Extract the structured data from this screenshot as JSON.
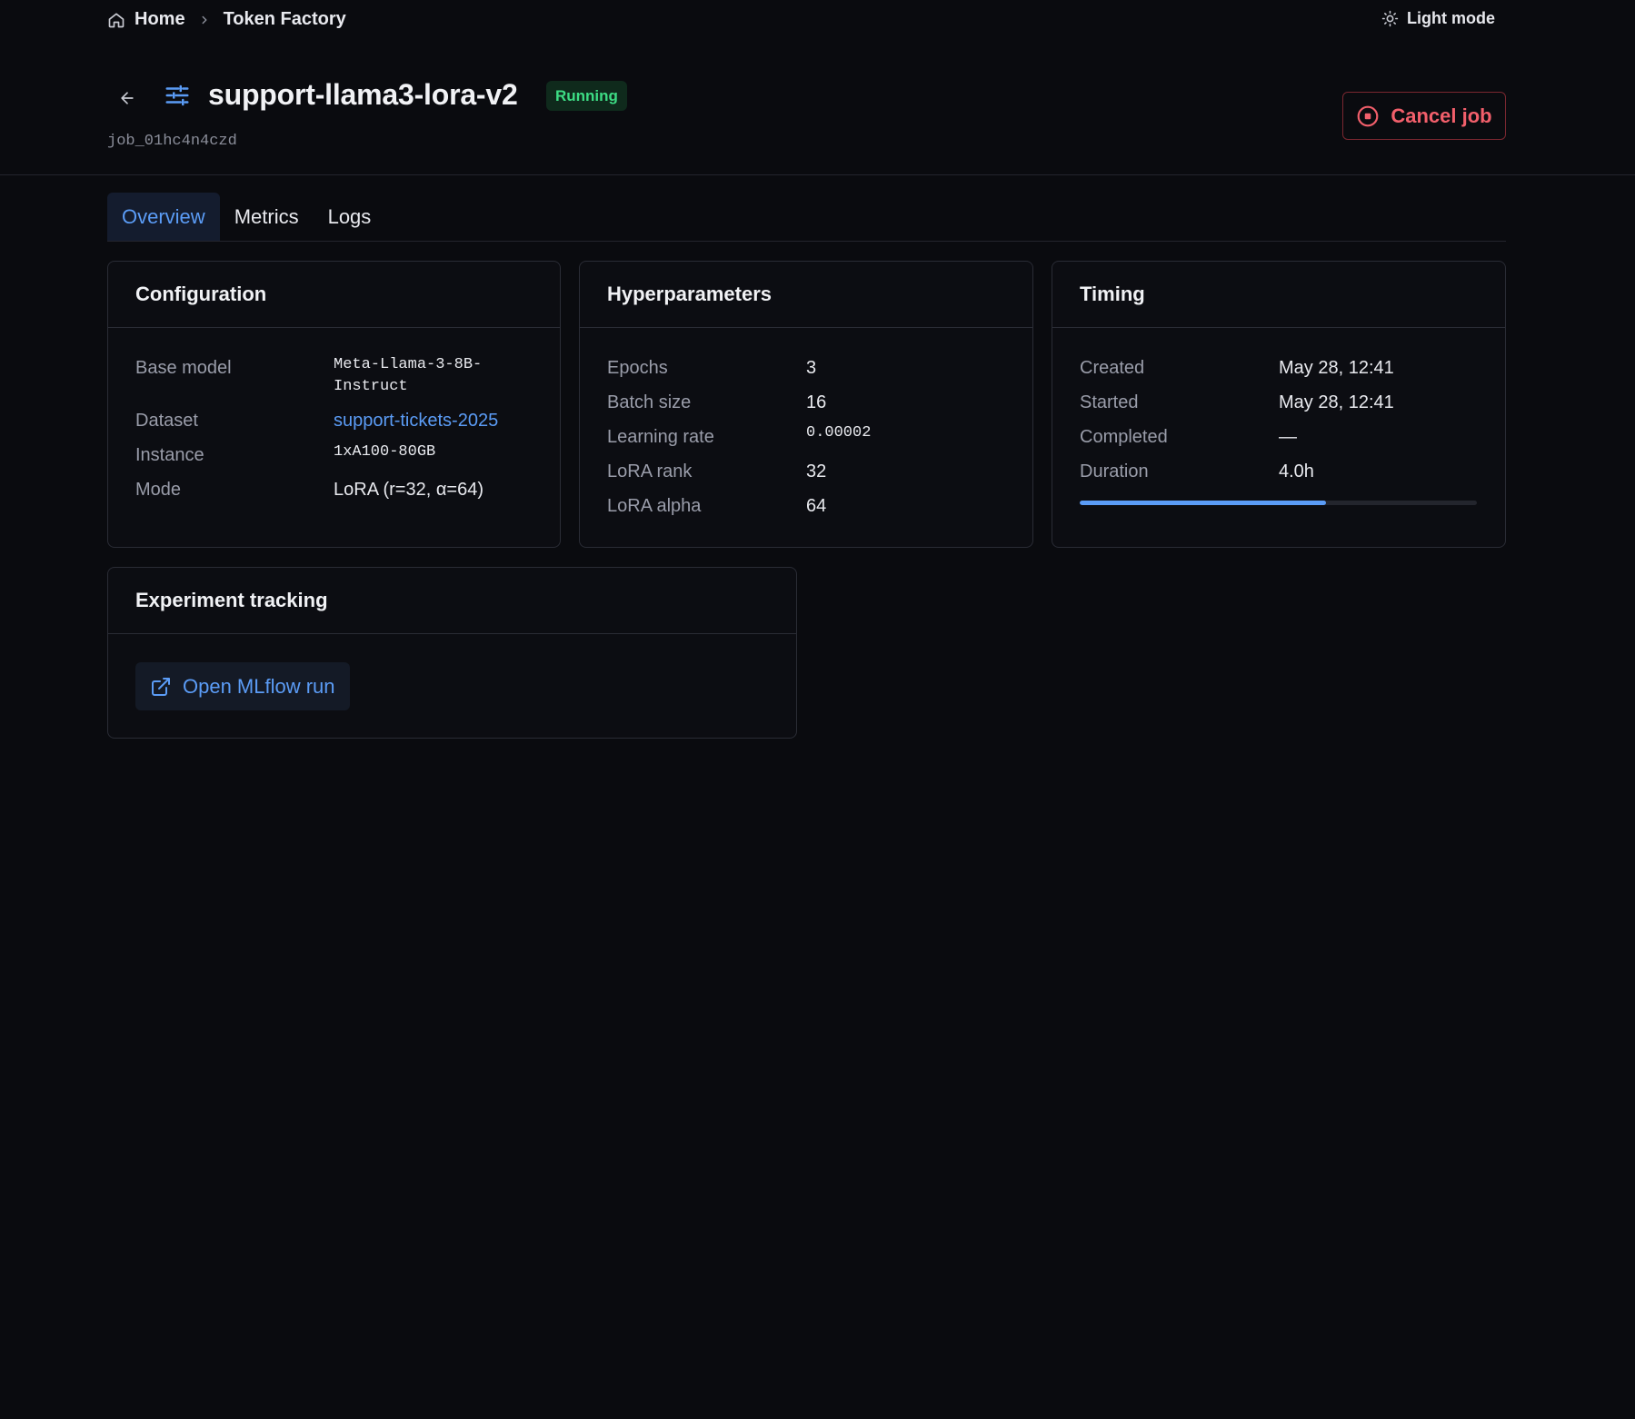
{
  "breadcrumb": {
    "home_label": "Home",
    "current_label": "Token Factory"
  },
  "theme_toggle": {
    "label": "Light mode",
    "icon": "sun-icon"
  },
  "job": {
    "title": "support-llama3-lora-v2",
    "status": "Running",
    "id": "job_01hc4n4czd"
  },
  "actions": {
    "cancel_label": "Cancel job"
  },
  "tabs": [
    {
      "label": "Overview",
      "active": true
    },
    {
      "label": "Metrics",
      "active": false
    },
    {
      "label": "Logs",
      "active": false
    }
  ],
  "configuration": {
    "title": "Configuration",
    "rows": [
      {
        "label": "Base model",
        "value_line1": "Meta-Llama-3-8B-",
        "value_line2": "Instruct"
      },
      {
        "label": "Dataset",
        "value": "support-tickets-2025"
      },
      {
        "label": "Instance",
        "value": "1xA100-80GB"
      },
      {
        "label": "Mode",
        "value": "LoRA (r=32, α=64)"
      }
    ]
  },
  "hyperparameters": {
    "title": "Hyperparameters",
    "rows": [
      {
        "label": "Epochs",
        "value": "3"
      },
      {
        "label": "Batch size",
        "value": "16"
      },
      {
        "label": "Learning rate",
        "value": "0.00002"
      },
      {
        "label": "LoRA rank",
        "value": "32"
      },
      {
        "label": "LoRA alpha",
        "value": "64"
      }
    ]
  },
  "timing": {
    "title": "Timing",
    "rows": [
      {
        "label": "Created",
        "value": "May 28, 12:41"
      },
      {
        "label": "Started",
        "value": "May 28, 12:41"
      },
      {
        "label": "Completed",
        "value": "—"
      },
      {
        "label": "Duration",
        "value": "4.0h"
      }
    ],
    "progress_percent": 62
  },
  "experiment_tracking": {
    "title": "Experiment tracking",
    "button_label": "Open MLflow run"
  },
  "colors": {
    "background": "#0a0b0f",
    "accent": "#5b9cf6",
    "running": "#3ddc84",
    "danger": "#f25f6b"
  }
}
